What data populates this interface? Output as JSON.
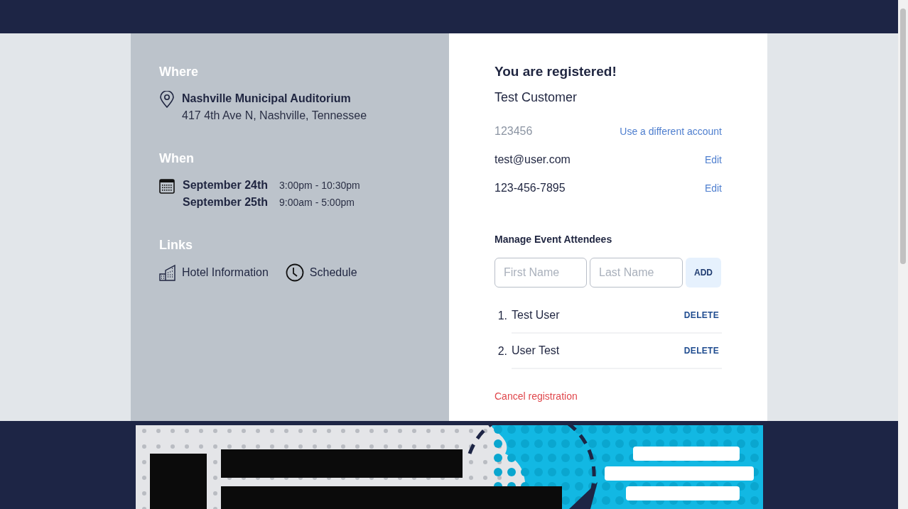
{
  "where": {
    "heading": "Where",
    "venue": "Nashville Municipal Auditorium",
    "address": "417 4th Ave N, Nashville, Tennessee"
  },
  "when": {
    "heading": "When",
    "dates": [
      {
        "date": "September 24th",
        "time": "3:00pm - 10:30pm"
      },
      {
        "date": "September 25th",
        "time": "9:00am - 5:00pm"
      }
    ]
  },
  "links": {
    "heading": "Links",
    "items": [
      {
        "kind": "hotel",
        "label": "Hotel Information"
      },
      {
        "kind": "clock",
        "label": "Schedule"
      }
    ]
  },
  "registration": {
    "title": "You are registered!",
    "name": "Test Customer",
    "fields": [
      {
        "kind": "account",
        "value": "123456",
        "action": "Use a different account"
      },
      {
        "kind": "contact",
        "value": "test@user.com",
        "action": "Edit"
      },
      {
        "kind": "contact",
        "value": "123-456-7895",
        "action": "Edit"
      }
    ]
  },
  "attendees": {
    "heading": "Manage Event Attendees",
    "first_name": {
      "placeholder": "First Name"
    },
    "last_name": {
      "placeholder": "Last Name"
    },
    "add_button": "ADD",
    "list": [
      {
        "number": "1.",
        "name": "Test User",
        "action": "DELETE"
      },
      {
        "number": "2.",
        "name": "User Test",
        "action": "DELETE"
      }
    ]
  },
  "cancel_link": "Cancel registration"
}
